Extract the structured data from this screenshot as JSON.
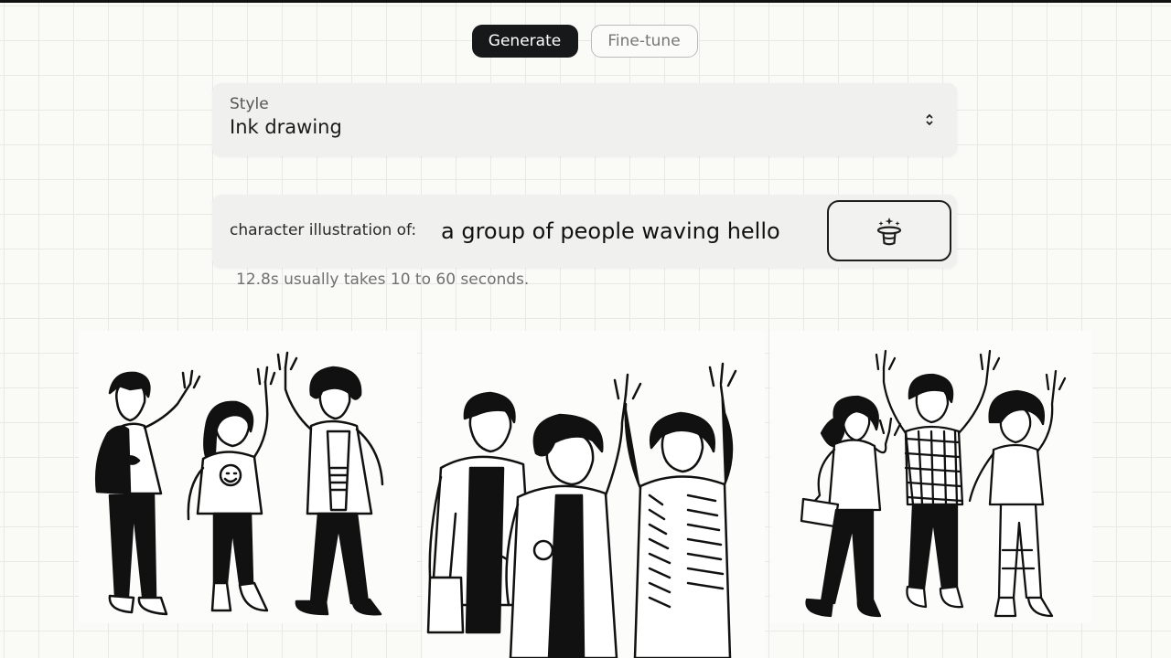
{
  "tabs": [
    {
      "label": "Generate",
      "active": true
    },
    {
      "label": "Fine-tune",
      "active": false
    }
  ],
  "style_select": {
    "label": "Style",
    "value": "Ink drawing"
  },
  "prompt": {
    "prefix": "character illustration of:",
    "value": "a group of people waving hello",
    "generate_icon": "magic-hat-icon"
  },
  "status": {
    "text": "12.8s usually takes 10 to 60 seconds."
  },
  "results": [
    {
      "people": 3
    },
    {
      "people": 3
    },
    {
      "people": 3
    }
  ],
  "colors": {
    "accent_dark": "#161819",
    "background": "#fafaf7",
    "card": "#f0f0ee"
  }
}
